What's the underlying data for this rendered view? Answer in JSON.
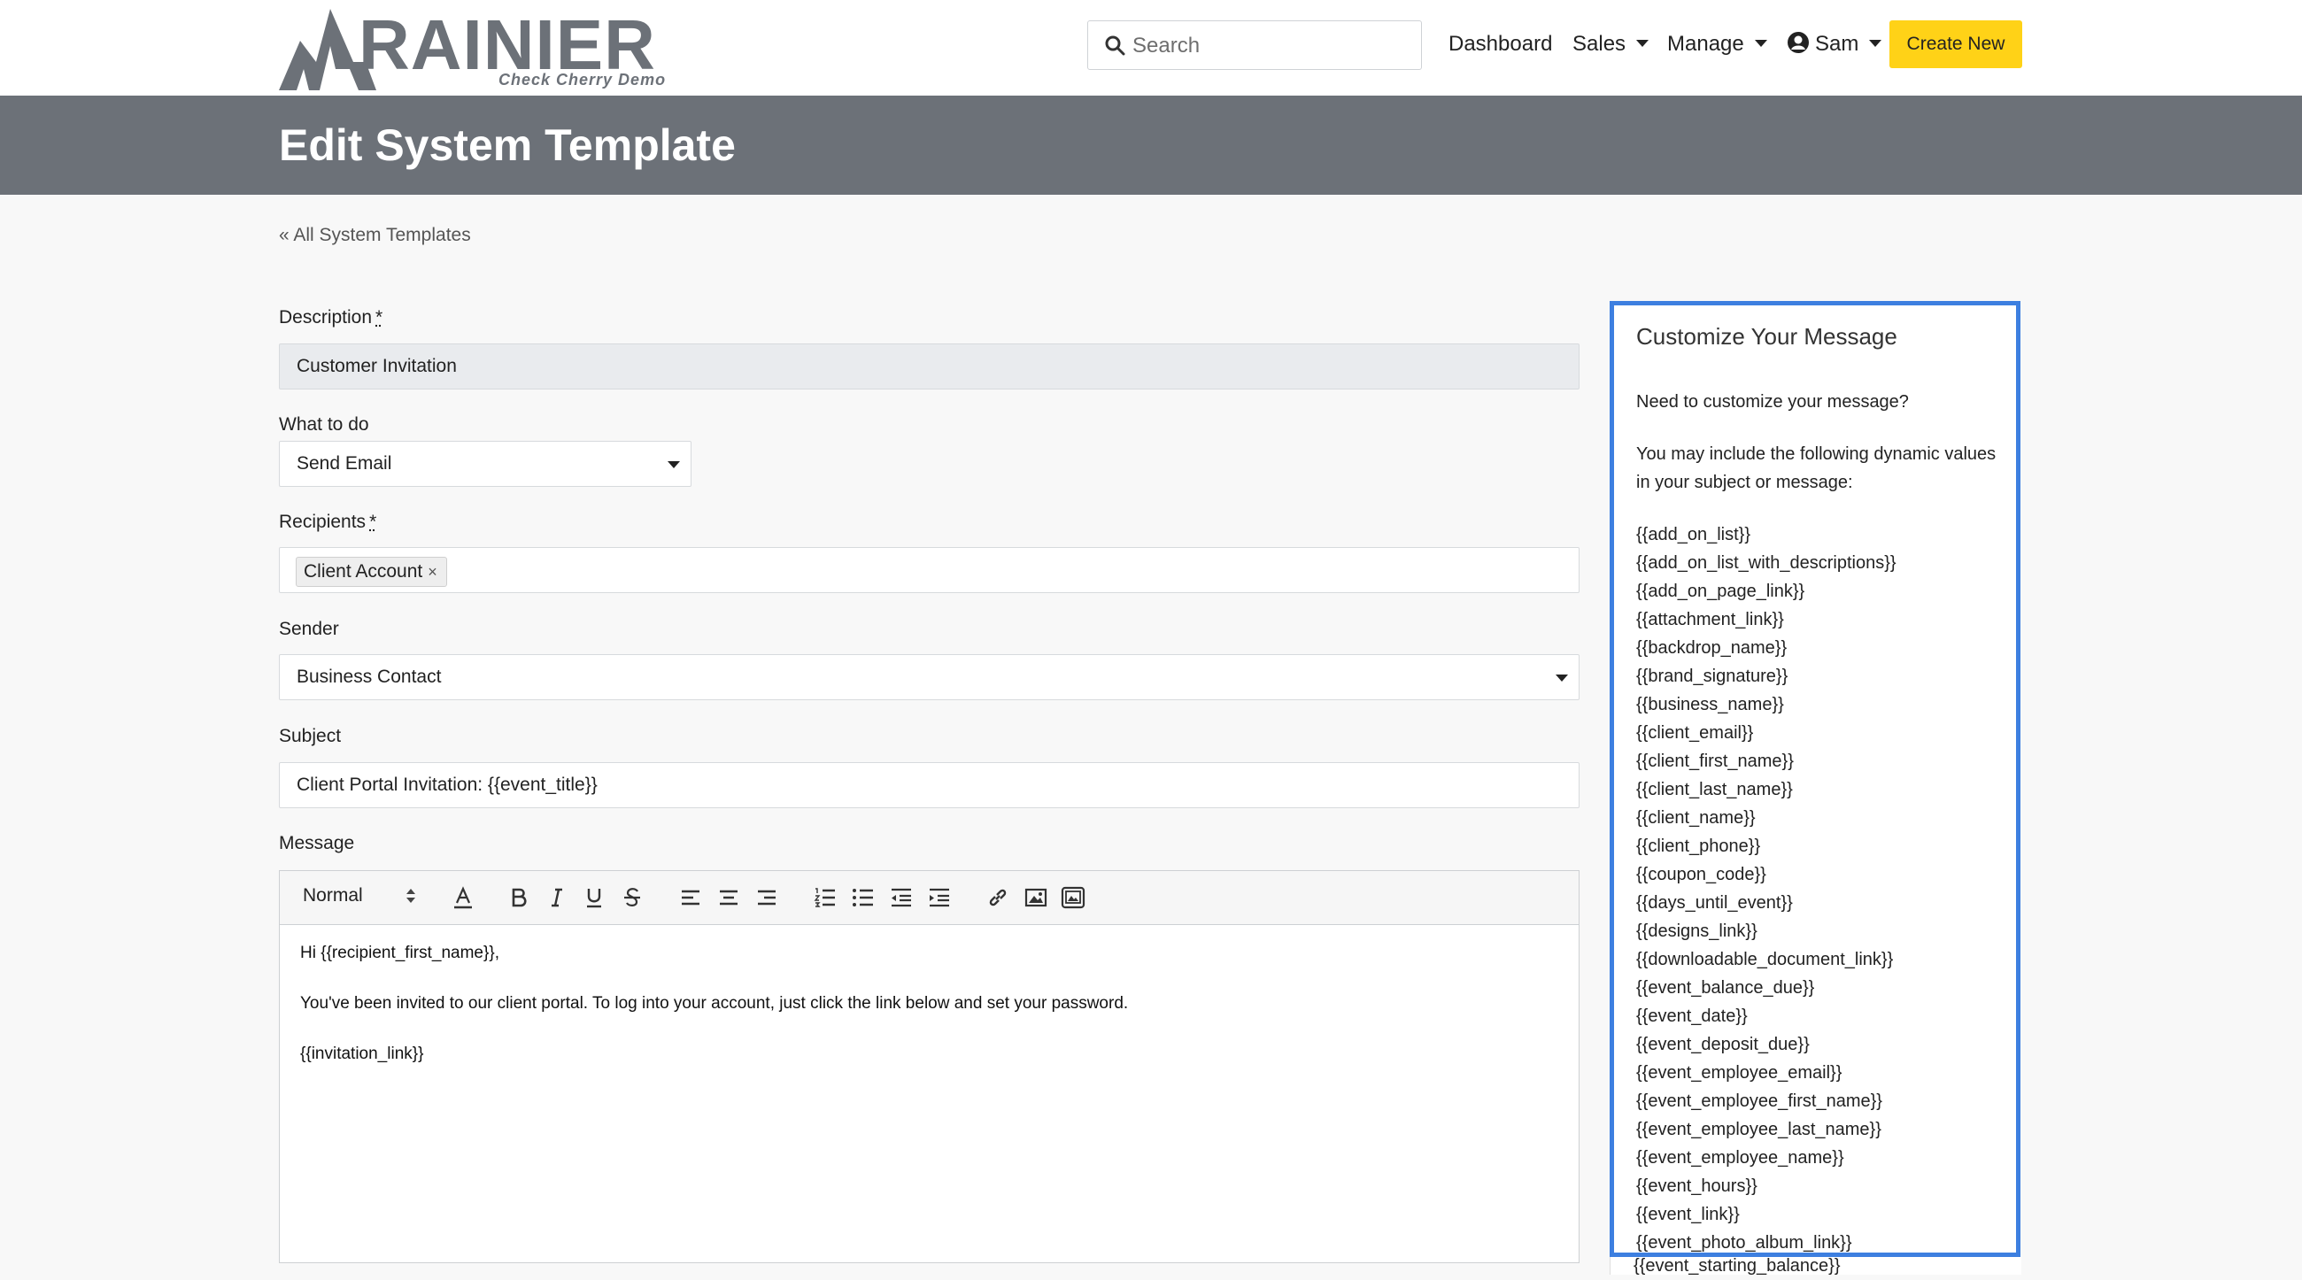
{
  "brand": {
    "name": "RAINIER",
    "subtitle": "Check Cherry Demo"
  },
  "nav": {
    "search_placeholder": "Search",
    "dashboard": "Dashboard",
    "sales": "Sales",
    "manage": "Manage",
    "user": "Sam",
    "create_new": "Create New"
  },
  "page": {
    "title": "Edit System Template",
    "back_link": "« All System Templates"
  },
  "form": {
    "description_label": "Description",
    "description_value": "Customer Invitation",
    "what_to_do_label": "What to do",
    "what_to_do_value": "Send Email",
    "recipients_label": "Recipients",
    "recipients_tags": [
      "Client Account"
    ],
    "required_mark": "*",
    "sender_label": "Sender",
    "sender_value": "Business Contact",
    "subject_label": "Subject",
    "subject_value": "Client Portal Invitation: {{event_title}}",
    "message_label": "Message"
  },
  "editor": {
    "format_value": "Normal",
    "paragraphs": [
      "Hi {{recipient_first_name}},",
      "You've been invited to our client portal. To log into your account, just click the link below and set your password.",
      "{{invitation_link}}"
    ]
  },
  "sidebar": {
    "title": "Customize Your Message",
    "intro": "Need to customize your message?",
    "description": "You may include the following dynamic values in your subject or message:",
    "variables": [
      "{{add_on_list}}",
      "{{add_on_list_with_descriptions}}",
      "{{add_on_page_link}}",
      "{{attachment_link}}",
      "{{backdrop_name}}",
      "{{brand_signature}}",
      "{{business_name}}",
      "{{client_email}}",
      "{{client_first_name}}",
      "{{client_last_name}}",
      "{{client_name}}",
      "{{client_phone}}",
      "{{coupon_code}}",
      "{{days_until_event}}",
      "{{designs_link}}",
      "{{downloadable_document_link}}",
      "{{event_balance_due}}",
      "{{event_date}}",
      "{{event_deposit_due}}",
      "{{event_employee_email}}",
      "{{event_employee_first_name}}",
      "{{event_employee_last_name}}",
      "{{event_employee_name}}",
      "{{event_hours}}",
      "{{event_link}}",
      "{{event_photo_album_link}}"
    ],
    "overflow_variable": "{{event_starting_balance}}"
  },
  "colors": {
    "header_bg": "#6c7178",
    "accent_button": "#ffd217",
    "panel_border": "#3d7fe0"
  }
}
